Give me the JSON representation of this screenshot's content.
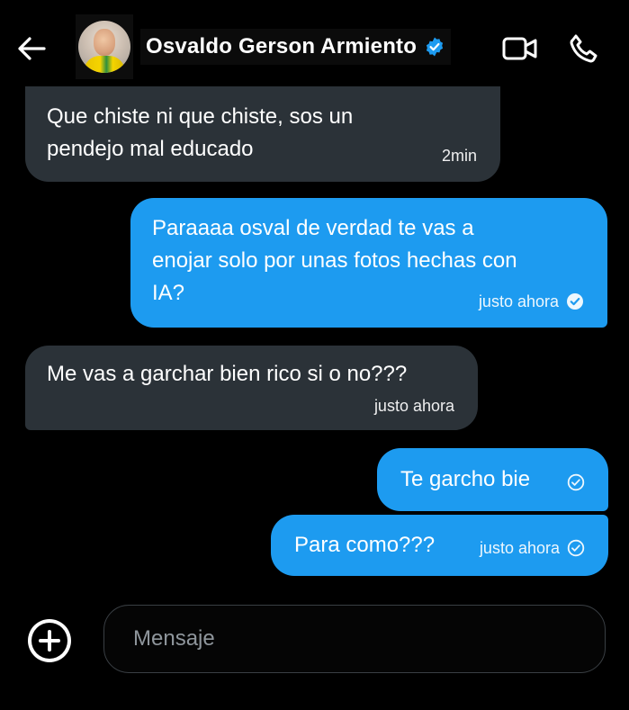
{
  "header": {
    "contact_name": "Osvaldo Gerson Armiento",
    "icons": {
      "back": "arrow-left-icon",
      "verified": "verified-badge-icon",
      "video": "video-camera-icon",
      "call": "phone-icon"
    }
  },
  "messages": [
    {
      "direction": "incoming",
      "text": "Que chiste ni que chiste, sos un\npendejo mal educado",
      "time": "2min"
    },
    {
      "direction": "outgoing",
      "text": "Paraaaa osval de verdad te vas a\nenojar solo por unas fotos hechas con\nIA?",
      "time": "justo ahora",
      "status_icon": "seen-check-icon"
    },
    {
      "direction": "incoming",
      "text": "Me vas a garchar bien rico si o no???",
      "time": "justo ahora"
    },
    {
      "direction": "outgoing",
      "text": "Te garcho bie",
      "time": "",
      "status_icon": "sent-check-icon"
    },
    {
      "direction": "outgoing",
      "text": "Para como???",
      "time": "justo ahora",
      "status_icon": "sent-check-icon"
    }
  ],
  "composer": {
    "placeholder": "Mensaje",
    "value": "",
    "add_icon": "plus-circle-icon"
  },
  "colors": {
    "background": "#000000",
    "incoming_bubble": "#2b3238",
    "outgoing_bubble": "#1d9bf0",
    "verified": "#1d9bf0"
  }
}
